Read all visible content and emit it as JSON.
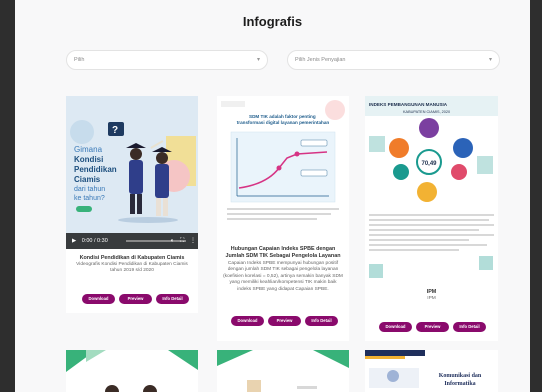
{
  "page": {
    "title": "Infografis"
  },
  "filters": {
    "first": {
      "value": "Pilih",
      "chevron": "chevron-down-icon"
    },
    "second": {
      "value": "Pilih Jenis Penyajian",
      "chevron": "chevron-down-icon"
    }
  },
  "cards": [
    {
      "title": "Kondisi Pendidikan di Kabupaten Ciamis",
      "desc": "Videografis Kondisi Pendidikan di Kabupaten Ciamis tahun 2019 s/d 2020",
      "thumb": {
        "text_line1": "Gimana",
        "text_line2": "Kondisi",
        "text_line3": "Pendidikan",
        "text_line4": "Ciamis",
        "text_line5": "dari tahun",
        "text_line6": "ke tahun?",
        "question_mark": "?"
      },
      "video": {
        "time": "0:00 / 0:30"
      },
      "buttons": {
        "download": "Download",
        "preview": "Preview",
        "detail": "Info Detail"
      }
    },
    {
      "title": "Hubungan Capaian Indeks SPBE dengan Jumlah SDM TIK Sebagai Pengelola Layanan",
      "desc": "Capaian Indeks SPBE mempunyai hubungan positif dengan jumlah SDM TIK sebagai pengelola layanan (koefisien korelasi = 0,52), artinya semakin banyak SDM yang memiliki keahlian/kompetensi TIK makin baik indeks SPBE yang didapat Capaian SPBE.",
      "thumb": {
        "heading": "SDM TIK adalah faktor penting transformasi digital layanan pemerintahan"
      },
      "buttons": {
        "download": "Download",
        "preview": "Preview",
        "detail": "Info Detail"
      }
    },
    {
      "title": "IPM",
      "desc": "IPM",
      "thumb": {
        "heading": "INDEKS PEMBANGUNAN MANUSIA",
        "subheading": "KABUPATEN CIAMIS, 2020",
        "value": "70,49"
      },
      "buttons": {
        "download": "Download",
        "preview": "Preview",
        "detail": "Info Detail"
      }
    }
  ],
  "bottom_cards": [
    {
      "text": ""
    },
    {
      "text": ""
    },
    {
      "line1": "Komunikasi dan",
      "line2": "Informatika"
    }
  ],
  "colors": {
    "button": "#8a0a6c",
    "accent_blue": "#1f5d8c",
    "ipm_teal": "#1a9a8f"
  }
}
